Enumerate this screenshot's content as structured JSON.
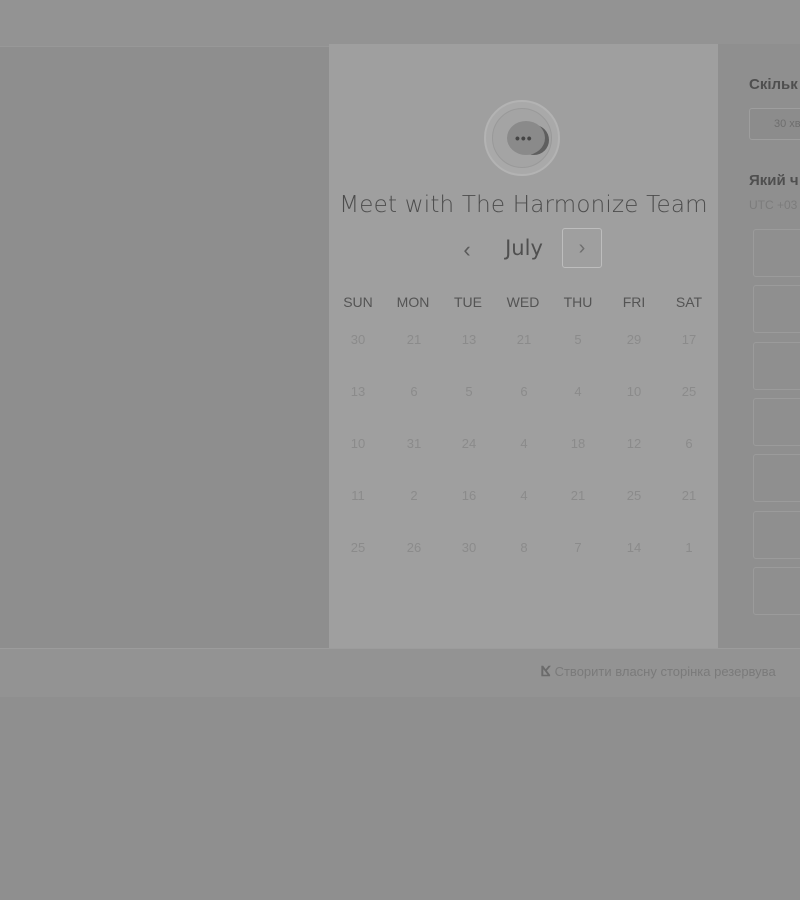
{
  "calendar": {
    "title": "Meet with The Harmonize Team",
    "month": "July",
    "prev_icon": "chevron-left-icon",
    "next_icon": "chevron-right-icon",
    "weekdays": [
      "SUN",
      "MON",
      "TUE",
      "WED",
      "THU",
      "FRI",
      "SAT"
    ],
    "weeks": [
      [
        "30",
        "21",
        "13",
        "21",
        "5",
        "29",
        "17"
      ],
      [
        "13",
        "6",
        "5",
        "6",
        "4",
        "10",
        "25"
      ],
      [
        "10",
        "31",
        "24",
        "4",
        "18",
        "12",
        "6"
      ],
      [
        "11",
        "2",
        "16",
        "4",
        "21",
        "25",
        "21"
      ],
      [
        "25",
        "26",
        "30",
        "8",
        "7",
        "14",
        "1"
      ]
    ]
  },
  "right_panel": {
    "duration_heading": "Скільк",
    "duration_value": "30 хв",
    "time_heading": "Який ч",
    "timezone": "UTC +03",
    "slots": [
      "",
      "",
      "",
      "",
      "",
      "",
      ""
    ]
  },
  "footer": {
    "link_text": "Створити власну сторінка резервува",
    "brand_icon": "hubspot-logo-icon"
  },
  "colors": {
    "overlay_bg": "#8f8f8f",
    "card_bg": "#9f9f9f",
    "text_dark": "#4c4c4c"
  }
}
